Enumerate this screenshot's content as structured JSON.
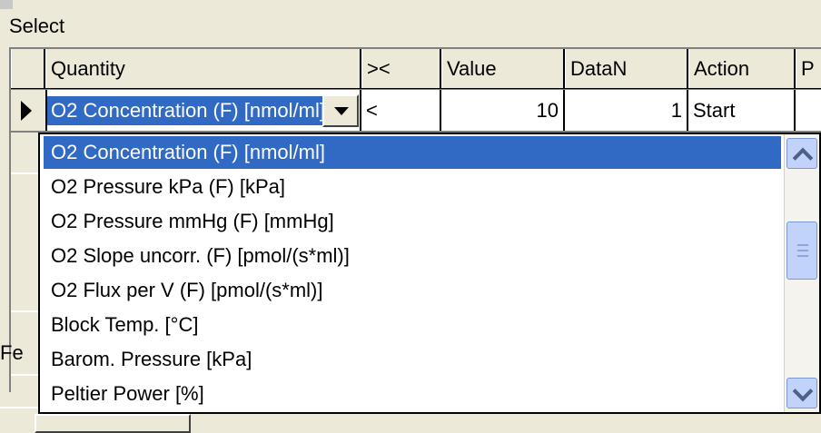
{
  "group_label": "Select",
  "left_label": "Fe",
  "columns": [
    "Quantity",
    "><",
    "Value",
    "DataN",
    "Action",
    "P"
  ],
  "row": {
    "quantity": "O2 Concentration (F) [nmol/ml]",
    "operator": "<",
    "value": "10",
    "datan": "1",
    "action": "Start",
    "extra": ""
  },
  "dropdown_items": [
    "O2 Concentration (F) [nmol/ml]",
    "O2 Pressure kPa (F) [kPa]",
    "O2 Pressure mmHg (F) [mmHg]",
    "O2 Slope uncorr. (F) [pmol/(s*ml)]",
    "O2 Flux per V (F) [pmol/(s*ml)]",
    "Block Temp. [°C]",
    "Barom. Pressure [kPa]",
    "Peltier Power [%]"
  ],
  "selected_index": 0,
  "icons": {
    "row_indicator": "triangle-right-icon",
    "combo_button": "chevron-down-icon",
    "scroll_up": "chevron-up-icon",
    "scroll_down": "chevron-down-icon"
  },
  "colors": {
    "selection": "#316ac5",
    "window_bg": "#ece9d8",
    "scroll_blue": "#c1d3fb"
  }
}
